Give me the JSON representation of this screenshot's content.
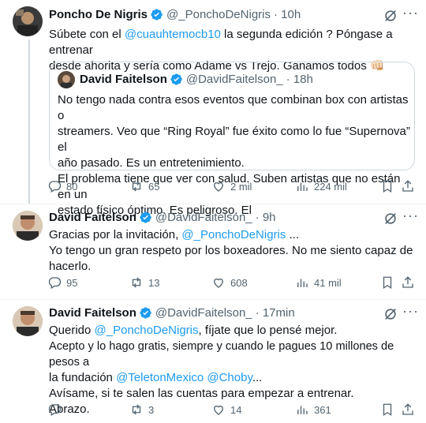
{
  "tweets": [
    {
      "name": "Poncho De Nigris",
      "handle": "@_PonchoDeNigris",
      "time": "· 10h",
      "text_line1_pre": "Súbete con el ",
      "text_line1_mention": "@cuauhtemocb10",
      "text_line1_post": "  la segunda edición ? Póngase a entrenar",
      "text_line2": "desde ahorita y sería como Adame vs Trejo. Ganamos todos 👊🏻",
      "quote": {
        "name": "David Faitelson",
        "handle": "@DavidFaitelson_",
        "time": "· 18h",
        "lines": [
          "No tengo nada contra esos eventos que combinan box con artistas o",
          "streamers. Veo que “Ring Royal” fue éxito como lo fue “Supernova” el",
          "año pasado. Es un entretenimiento.",
          "El problema tiene que ver con salud. Suben artistas que no están en un",
          "estado físico óptimo. Es peligroso. El"
        ]
      },
      "stats": {
        "replies": "80",
        "retweets": "65",
        "likes": "2 mil",
        "views": "224 mil"
      }
    },
    {
      "name": "David Faitelson",
      "handle": "@DavidFaitelson_",
      "time": "· 9h",
      "line1_pre": "Gracias por la invitación, ",
      "line1_mention": "@_PonchoDeNigris",
      "line1_post": " ...",
      "line2": "Yo tengo un gran respeto por los boxeadores. No me siento capaz de",
      "line3": "hacerlo.",
      "stats": {
        "replies": "95",
        "retweets": "13",
        "likes": "608",
        "views": "41 mil"
      }
    },
    {
      "name": "David Faitelson",
      "handle": "@DavidFaitelson_",
      "time": "· 17min",
      "line1_pre": "Querido ",
      "line1_mention": "@_PonchoDeNigris",
      "line1_post": ", fíjate que lo pensé mejor.",
      "line2": "Acepto y lo hago gratis, siempre y cuando le pagues 10 millones de pesos a",
      "line3_pre": "la fundación ",
      "line3_mention1": "@TeletonMexico",
      "line3_mention2": "@Choby",
      "line3_post": "...",
      "line4": "Avísame, si te salen las cuentas para empezar a entrenar.",
      "line5": "Abrazo.",
      "stats": {
        "replies": "",
        "retweets": "3",
        "likes": "14",
        "views": "361"
      }
    }
  ],
  "colors": {
    "accent": "#1d9bf0",
    "text": "#0f1419",
    "muted": "#536471",
    "border": "#cfd9de"
  },
  "icons": [
    "verified-badge-icon",
    "grok-icon",
    "more-icon",
    "reply-icon",
    "retweet-icon",
    "like-icon",
    "views-icon",
    "bookmark-icon",
    "share-icon"
  ]
}
